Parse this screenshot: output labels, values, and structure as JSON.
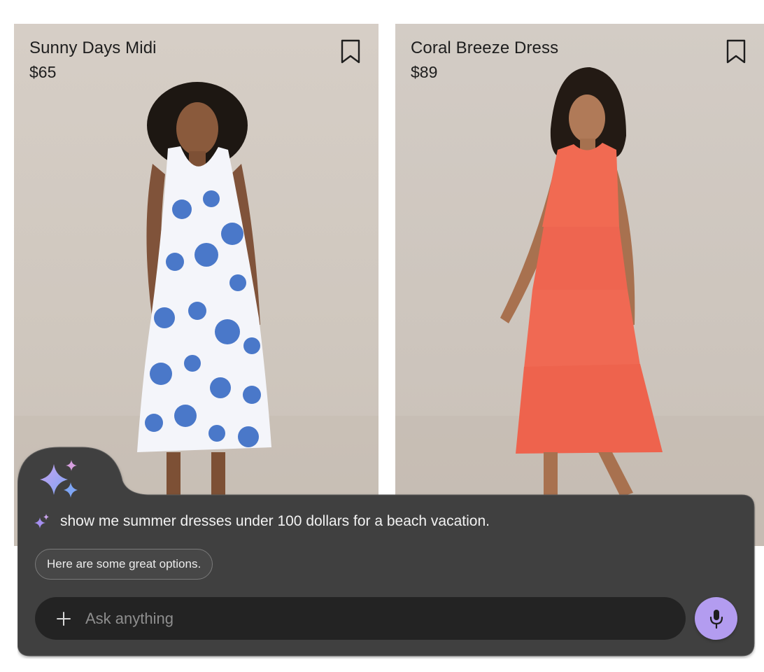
{
  "products": [
    {
      "title": "Sunny Days Midi",
      "price": "$65",
      "dress_color": "#4a78c9",
      "bookmark_icon": "bookmark-icon"
    },
    {
      "title": "Coral Breeze Dress",
      "price": "$89",
      "dress_color": "#f0674f",
      "bookmark_icon": "bookmark-icon"
    }
  ],
  "assistant": {
    "prompt": "show me summer dresses under 100 dollars for a beach vacation.",
    "reply": "Here are some great options.",
    "input_placeholder": "Ask anything",
    "accent_color": "#b39cf0",
    "panel_color": "#3f3f3f",
    "icons": [
      "sparkle-icon",
      "plus-icon",
      "microphone-icon"
    ]
  }
}
